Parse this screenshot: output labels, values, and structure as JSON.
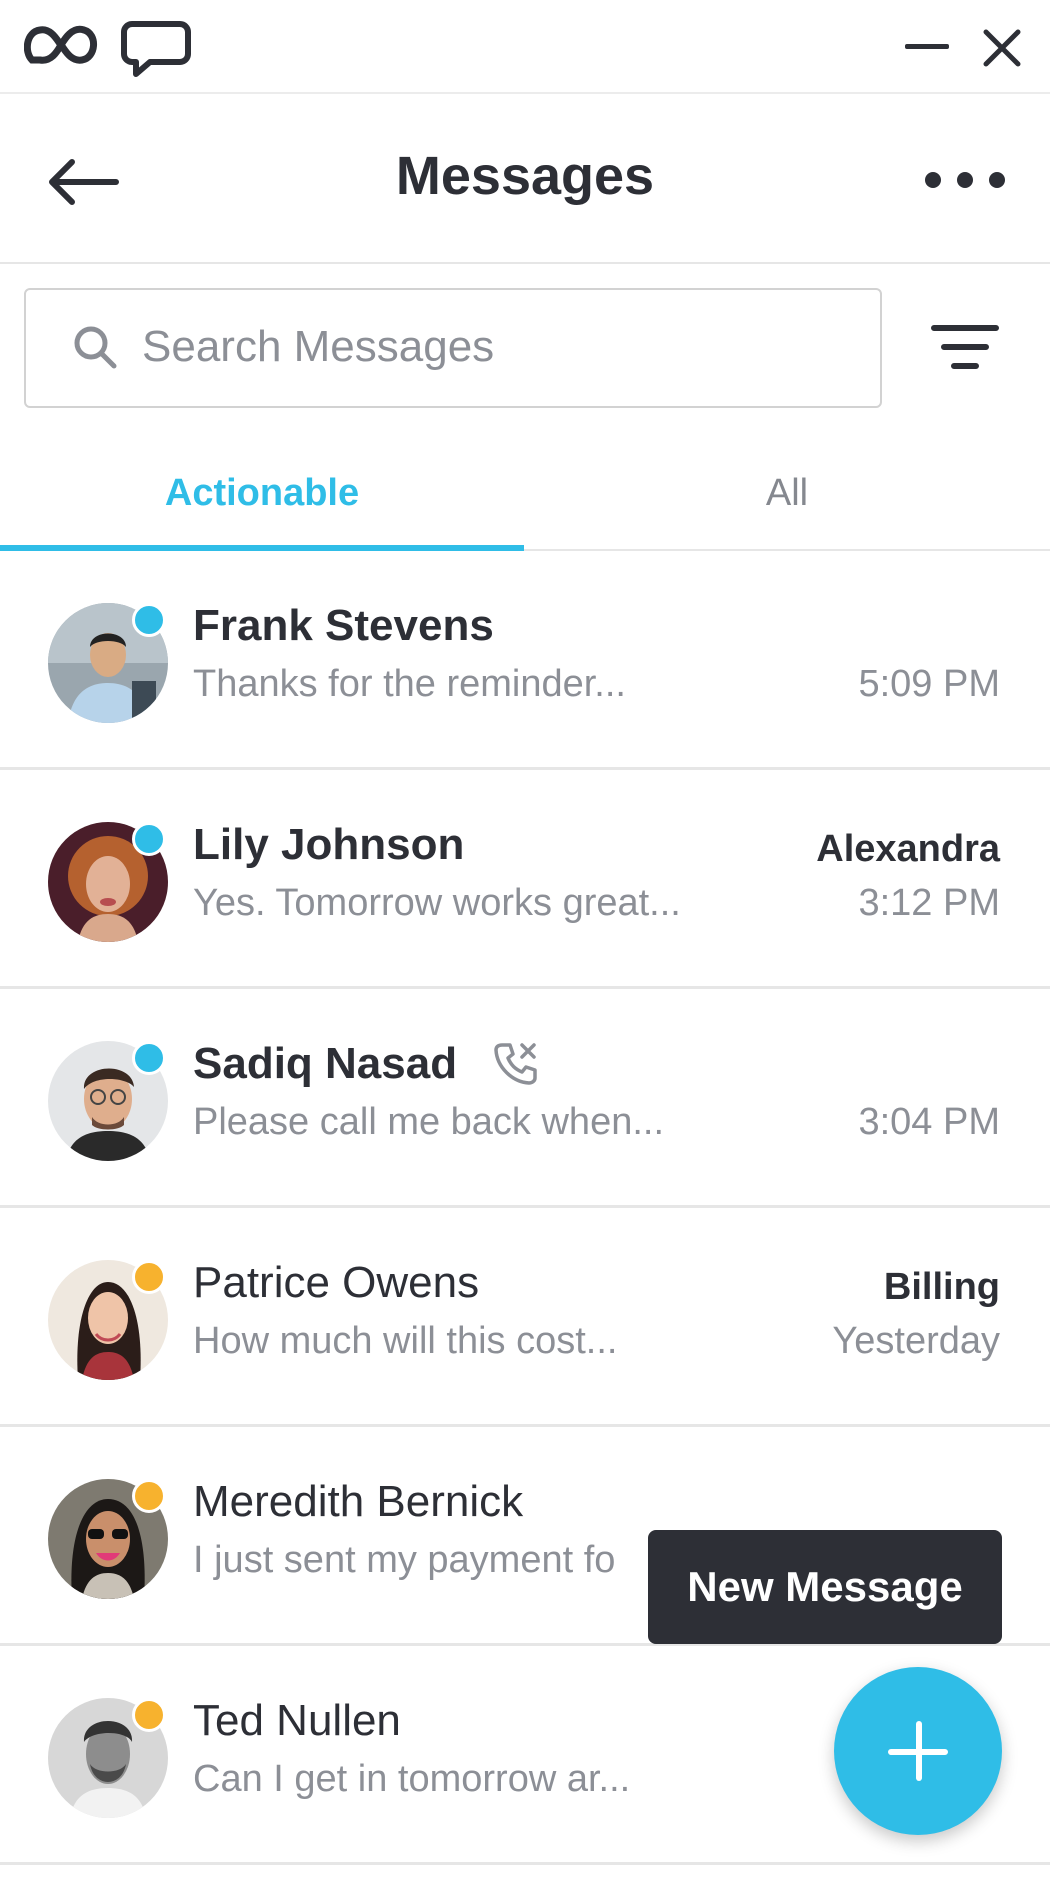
{
  "header": {
    "title": "Messages"
  },
  "search": {
    "placeholder": "Search Messages"
  },
  "tabs": [
    {
      "label": "Actionable",
      "active": true
    },
    {
      "label": "All",
      "active": false
    }
  ],
  "conversations": [
    {
      "name": "Frank Stevens",
      "preview": "Thanks for the reminder...",
      "time": "5:09 PM",
      "assignee": "",
      "status": "blue",
      "unread": true
    },
    {
      "name": "Lily Johnson",
      "preview": "Yes. Tomorrow works great...",
      "time": "3:12 PM",
      "assignee": "Alexandra",
      "status": "blue",
      "unread": true
    },
    {
      "name": "Sadiq Nasad",
      "preview": "Please call me back when...",
      "time": "3:04 PM",
      "assignee": "",
      "status": "blue",
      "unread": true,
      "icon": "missed-call-icon"
    },
    {
      "name": "Patrice Owens",
      "preview": "How much will this cost...",
      "time": "Yesterday",
      "assignee": "Billing",
      "status": "orange",
      "unread": false
    },
    {
      "name": "Meredith Bernick",
      "preview": "I just sent my payment fo",
      "time": "",
      "assignee": "",
      "status": "orange",
      "unread": false
    },
    {
      "name": "Ted Nullen",
      "preview": "Can I get in tomorrow ar...",
      "time": "",
      "assignee": "",
      "status": "orange",
      "unread": false
    }
  ],
  "tooltip": {
    "label": "New Message"
  },
  "colors": {
    "accent": "#2fbde7",
    "status_blue": "#2fbde7",
    "status_orange": "#f7b22e",
    "dark": "#2d2f36"
  }
}
